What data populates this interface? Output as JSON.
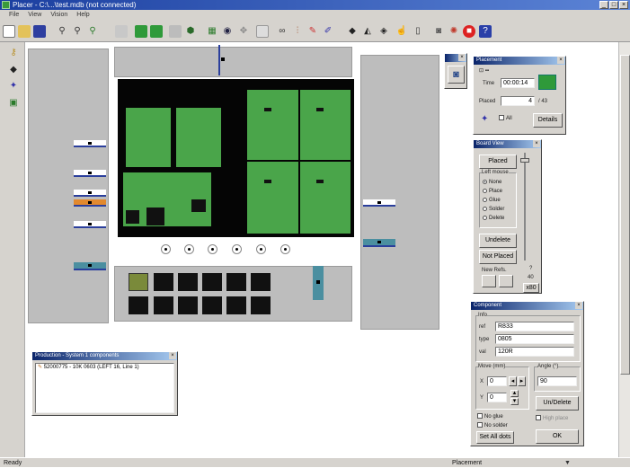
{
  "window": {
    "title": "Placer - C:\\...\\test.mdb (not connected)"
  },
  "menu": [
    "File",
    "View",
    "Vision",
    "Help"
  ],
  "status": {
    "left": "Ready",
    "mode": "Placement"
  },
  "colors": {
    "pcb_green": "#4aa54a",
    "highlight_orange": "#e2892e",
    "feeder_teal": "#4b8fa0"
  },
  "production": {
    "title": "Production - System 1 components",
    "item": "52000775 - 10K 0603 (LEFT 16, Line 1)"
  },
  "placement": {
    "title": "Placement",
    "time_label": "Time",
    "time_value": "00:00:14",
    "placed_label": "Placed",
    "placed_value": "4",
    "placed_total": "/ 43",
    "all_label": "All",
    "details_button": "Details"
  },
  "board_view": {
    "title": "Board View",
    "placed_button": "Placed",
    "left_mouse_label": "Left mouse",
    "options": [
      "None",
      "Place",
      "Glue",
      "Solder",
      "Delete"
    ],
    "selected_option": "None",
    "undelete_button": "Undelete",
    "not_placed_button": "Not Placed",
    "new_refs_label": "New Refs.",
    "zoom_q": "?",
    "zoom_value": "40",
    "zoom_button": "x80"
  },
  "component": {
    "title": "Component",
    "info_label": "Info",
    "ref_label": "ref",
    "ref_value": "R833",
    "type_label": "type",
    "type_value": "0805",
    "val_label": "val",
    "val_value": "120R",
    "move_label": "Move (mm)",
    "angle_label": "Angle (°)",
    "x_label": "X",
    "x_value": "0",
    "y_label": "Y",
    "y_value": "0",
    "angle_value": "90",
    "undelete_button": "Un/Delete",
    "no_glue_label": "No glue",
    "no_solder_label": "No solder",
    "high_label": "High place",
    "set_all_button": "Set All dots",
    "ok_button": "OK"
  },
  "icons": [
    "new-file-icon",
    "open-folder-icon",
    "save-icon",
    "zoom-in-icon",
    "zoom-out-icon",
    "green-board-icon",
    "camera-icon",
    "pencil-icon",
    "stop-icon",
    "help-icon"
  ]
}
